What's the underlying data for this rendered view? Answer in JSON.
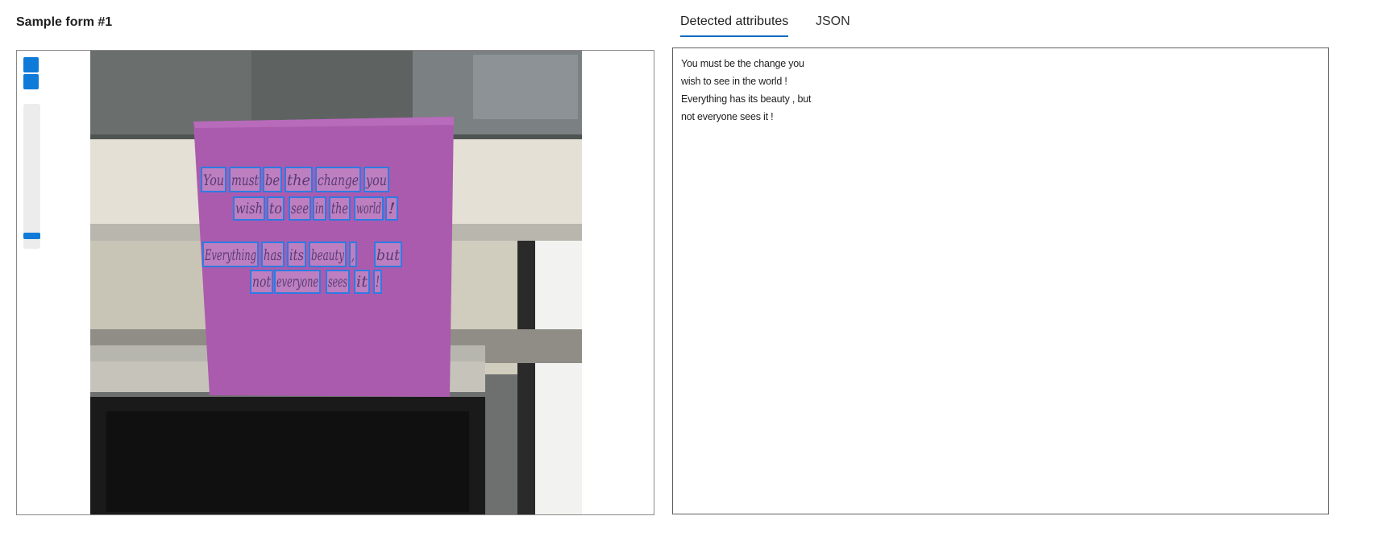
{
  "title": "Sample form #1",
  "tabs": [
    {
      "label": "Detected attributes",
      "active": true
    },
    {
      "label": "JSON",
      "active": false
    }
  ],
  "viewer": {
    "zoom_in_icon": "zoom-in-icon",
    "zoom_out_icon": "zoom-out-icon",
    "zoom_level_fraction": 0.07
  },
  "colors": {
    "accent": "#0f7bd8",
    "box": "#2d7be3",
    "note": "#ab5bae"
  },
  "note_words": [
    [
      "You",
      "must",
      "be",
      "the",
      "change",
      "you"
    ],
    [
      "wish",
      "to",
      "see",
      "in",
      "the",
      "world",
      "!"
    ],
    [
      "Everything",
      "has",
      "its",
      "beauty",
      ",",
      "but"
    ],
    [
      "not",
      "everyone",
      "sees",
      "it",
      "!"
    ]
  ],
  "lines": [
    "You must be the change you",
    "wish to see in the world !",
    "Everything has its beauty , but",
    "not everyone sees it !"
  ]
}
